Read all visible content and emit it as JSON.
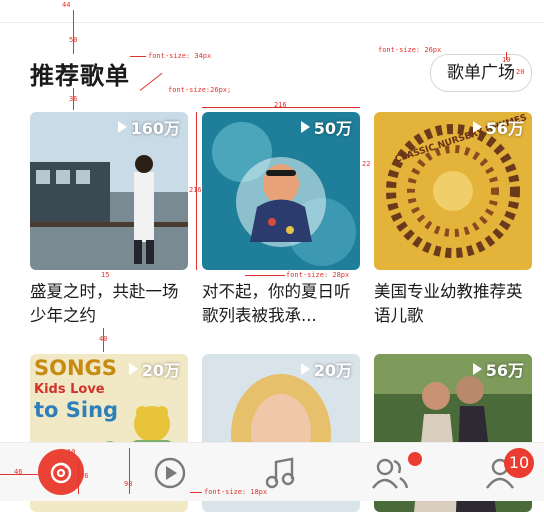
{
  "section": {
    "title": "推荐歌单",
    "more_label": "歌单广场"
  },
  "playlists": [
    {
      "plays": "160万",
      "caption": "盛夏之时，共赴一场少年之约"
    },
    {
      "plays": "50万",
      "caption": "对不起，你的夏日听歌列表被我承..."
    },
    {
      "plays": "56万",
      "caption": "美国专业幼教推荐英语儿歌"
    },
    {
      "plays": "20万",
      "caption": ""
    },
    {
      "plays": "20万",
      "caption": ""
    },
    {
      "plays": "56万",
      "caption": ""
    }
  ],
  "cover_text": {
    "songs": "SONGS",
    "kids": "Kids Love",
    "to_sing": "to Sing",
    "nursery": "CLASSIC NURSERY RHYMES"
  },
  "tabbar": {
    "badge_count": "10"
  },
  "annotations": {
    "a_44": "44",
    "a_50": "50",
    "a_36": "36",
    "a_15": "15",
    "a_40": "40",
    "a_216": "216",
    "a_216v": "216",
    "a_22": "22",
    "a_10a": "10",
    "a_20": "20",
    "a_10b": "10",
    "a_56": "56",
    "a_46": "46",
    "a_98": "98",
    "fs_title": "font-size: 34px",
    "fs_btn": "font-size: 26px",
    "fs_plays": "font-size:26px;",
    "fs_caption": "font-size: 28px",
    "fs_tab": "font-size: 18px"
  },
  "colors": {
    "accent": "#ea3c30",
    "annotation": "#e0342e"
  }
}
